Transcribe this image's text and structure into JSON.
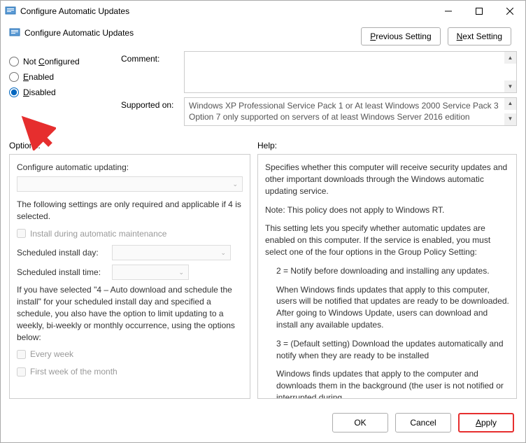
{
  "titlebar": {
    "title": "Configure Automatic Updates"
  },
  "header": {
    "title": "Configure Automatic Updates",
    "prev_button": "Previous Setting",
    "next_button": "Next Setting"
  },
  "radios": {
    "not_configured": "Not Configured",
    "enabled": "Enabled",
    "disabled": "Disabled",
    "selected": "disabled"
  },
  "fields": {
    "comment_label": "Comment:",
    "supported_label": "Supported on:",
    "supported_text": "Windows XP Professional Service Pack 1 or At least Windows 2000 Service Pack 3\nOption 7 only supported on servers of at least Windows Server 2016 edition"
  },
  "panels": {
    "options_label": "Options:",
    "help_label": "Help:"
  },
  "options": {
    "configure_label": "Configure automatic updating:",
    "note": "The following settings are only required and applicable if 4 is selected.",
    "install_maintenance": "Install during automatic maintenance",
    "sched_day_label": "Scheduled install day:",
    "sched_time_label": "Scheduled install time:",
    "schedule_note": "If you have selected \"4 – Auto download and schedule the install\" for your scheduled install day and specified a schedule, you also have the option to limit updating to a weekly, bi-weekly or monthly occurrence, using the options below:",
    "every_week": "Every week",
    "first_week": "First week of the month"
  },
  "help": {
    "p1": "Specifies whether this computer will receive security updates and other important downloads through the Windows automatic updating service.",
    "p2": "Note: This policy does not apply to Windows RT.",
    "p3": "This setting lets you specify whether automatic updates are enabled on this computer. If the service is enabled, you must select one of the four options in the Group Policy Setting:",
    "p4": "2 = Notify before downloading and installing any updates.",
    "p5": "When Windows finds updates that apply to this computer, users will be notified that updates are ready to be downloaded. After going to Windows Update, users can download and install any available updates.",
    "p6": "3 = (Default setting) Download the updates automatically and notify when they are ready to be installed",
    "p7": "Windows finds updates that apply to the computer and downloads them in the background (the user is not notified or interrupted during"
  },
  "footer": {
    "ok": "OK",
    "cancel": "Cancel",
    "apply": "Apply"
  }
}
